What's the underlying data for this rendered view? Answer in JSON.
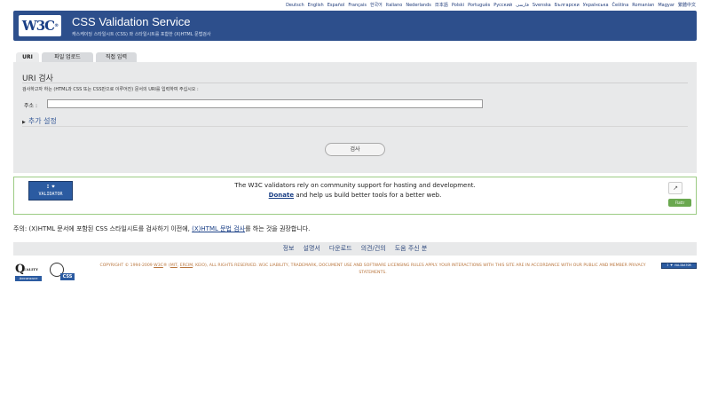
{
  "languages": [
    "Deutsch",
    "English",
    "Español",
    "Français",
    "한국어",
    "Italiano",
    "Nederlands",
    "日本語",
    "Polski",
    "Português",
    "Русский",
    "فارسی",
    "Svenska",
    "Български",
    "Українська",
    "Čeština",
    "Romanian",
    "Magyar",
    "繁體中文"
  ],
  "header": {
    "logo": "W3C",
    "logo_mark": "®",
    "title": "CSS Validation Service",
    "subtitle": "캐스케이딩 스타일시트 (CSS) 와 스타일시트를 포함한 (X)HTML 문법검사"
  },
  "tabs": [
    "URI",
    "파일 업로드",
    "직접 입력"
  ],
  "form": {
    "title": "URI 검사",
    "description": "검사하고자 하는 (HTML과 CSS 또는 CSS만으로 이루어진) 문서의 URI를 입력하여 주십시오 :",
    "address_label": "주소 :",
    "address_value": "",
    "more_options": "추가 설정",
    "submit_label": "검사"
  },
  "donate": {
    "badge_line1": "I ♥",
    "badge_line2": "VALIDATOR",
    "line1": "The W3C validators rely on community support for hosting and development.",
    "donate_link": "Donate",
    "line2_rest": " and help us build better tools for a better web.",
    "share_icon": "share-icon",
    "flattr_label": "Flattr"
  },
  "note": {
    "prefix": "주의: (X)HTML 문서에 포함된 CSS 스타일시트를 검사하기 이전에, ",
    "link": "(X)HTML 문법 검사",
    "suffix": "를 하는 것을 권장합니다."
  },
  "footer_nav": [
    "정보",
    "설명서",
    "다운로드",
    "의견/건의",
    "도움 주신 분"
  ],
  "footer": {
    "qa_letter": "Q",
    "qa_quality": "UALITY",
    "qa_assurance": "Assurance",
    "css_badge": "CSS",
    "copyright_start": "COPYRIGHT © 1994-2009 ",
    "w3c_link": "W3C",
    "copyright_mid1": "® (",
    "mit_link": "MIT",
    "comma1": ", ",
    "ercim_link": "ERCIM",
    "copyright_mid2": ", KEIO), ALL RIGHTS RESERVED. W3C LIABILITY, TRADEMARK, DOCUMENT USE AND SOFTWARE LICENSING RULES APPLY. YOUR INTERACTIONS WITH THIS SITE ARE IN ACCORDANCE WITH OUR PUBLIC AND MEMBER PRIVACY STATEMENTS.",
    "mini_badge": "I ♥ VALIDATOR"
  },
  "colors": {
    "banner": "#2d4f8c",
    "panel": "#e8e9ea",
    "donate_border": "#9ccb84",
    "copyright": "#b9763e"
  }
}
